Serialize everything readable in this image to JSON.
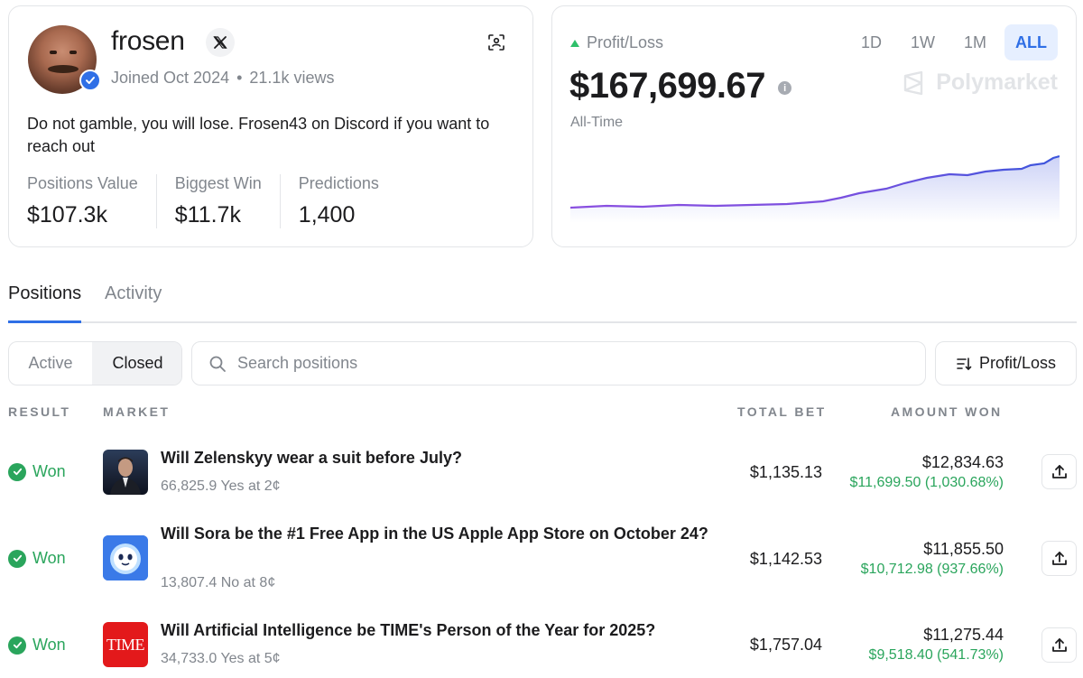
{
  "profile": {
    "username": "frosen",
    "joined": "Joined Oct 2024",
    "views": "21.1k views",
    "bio": "Do not gamble, you will lose. Frosen43 on Discord if you want to reach out",
    "stats": [
      {
        "label": "Positions Value",
        "value": "$107.3k"
      },
      {
        "label": "Biggest Win",
        "value": "$11.7k"
      },
      {
        "label": "Predictions",
        "value": "1,400"
      }
    ]
  },
  "pnl": {
    "label": "Profit/Loss",
    "value": "$167,699.67",
    "period": "All-Time",
    "brand": "Polymarket",
    "ranges": [
      "1D",
      "1W",
      "1M",
      "ALL"
    ],
    "active_range": "ALL",
    "colors": {
      "line_start": "#8a4fe0",
      "line_end": "#3b55dc",
      "up": "#2ec06a"
    }
  },
  "tabs": {
    "positions": "Positions",
    "activity": "Activity"
  },
  "filters": {
    "active": "Active",
    "closed": "Closed",
    "search_placeholder": "Search positions",
    "sort_label": "Profit/Loss"
  },
  "table": {
    "headers": {
      "result": "RESULT",
      "market": "MARKET",
      "total_bet": "TOTAL BET",
      "amount_won": "AMOUNT WON"
    },
    "rows": [
      {
        "result": "Won",
        "title": "Will Zelenskyy wear a suit before July?",
        "sub": "66,825.9 Yes at 2¢",
        "total_bet": "$1,135.13",
        "amount_won": "$12,834.63",
        "gain": "$11,699.50 (1,030.68%)"
      },
      {
        "result": "Won",
        "title": "Will Sora be the #1 Free App in the US Apple App Store on October 24?",
        "sub": "13,807.4 No at 8¢",
        "total_bet": "$1,142.53",
        "amount_won": "$11,855.50",
        "gain": "$10,712.98 (937.66%)"
      },
      {
        "result": "Won",
        "title": "Will Artificial Intelligence be TIME's Person of the Year for 2025?",
        "sub": "34,733.0 Yes at 5¢",
        "total_bet": "$1,757.04",
        "amount_won": "$11,275.44",
        "gain": "$9,518.40 (541.73%)",
        "thumb_text": "TIME"
      }
    ]
  }
}
